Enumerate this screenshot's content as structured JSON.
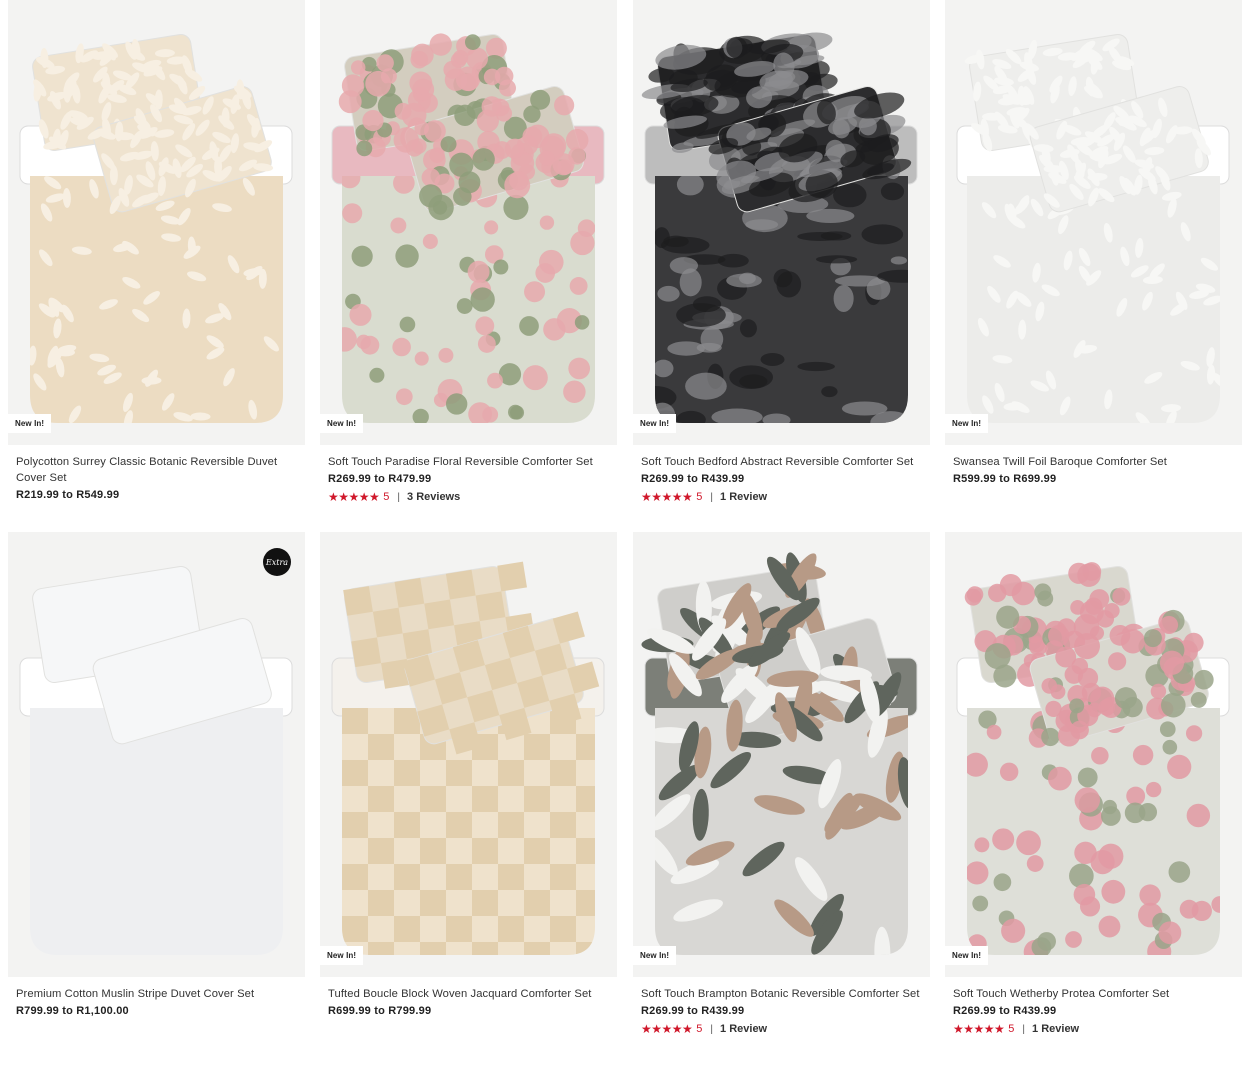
{
  "colors": {
    "accent": "#d0182b",
    "image_bg": "#f3f3f2"
  },
  "products": [
    {
      "title": "Polycotton Surrey Classic Botanic Reversible Duvet Cover Set",
      "price": "R219.99 to R549.99",
      "badge": "New In!",
      "pattern": "beige-botanic"
    },
    {
      "title": "Soft Touch Paradise Floral Reversible Comforter Set",
      "price": "R269.99 to R479.99",
      "badge": "New In!",
      "rating": {
        "stars": "★★★★★",
        "score": "5",
        "reviews": "3 Reviews"
      },
      "pattern": "pink-floral"
    },
    {
      "title": "Soft Touch Bedford Abstract Reversible Comforter Set",
      "price": "R269.99 to R439.99",
      "badge": "New In!",
      "rating": {
        "stars": "★★★★★",
        "score": "5",
        "reviews": "1 Review"
      },
      "pattern": "black-abstract"
    },
    {
      "title": "Swansea Twill Foil Baroque Comforter Set",
      "price": "R599.99 to R699.99",
      "badge": "New In!",
      "pattern": "white-baroque"
    },
    {
      "title": "Premium Cotton Muslin Stripe Duvet Cover Set",
      "price": "R799.99 to R1,100.00",
      "extra_badge": "Extra",
      "pattern": "white-plain"
    },
    {
      "title": "Tufted Boucle Block Woven Jacquard Comforter Set",
      "price": "R699.99 to R799.99",
      "badge": "New In!",
      "pattern": "beige-check"
    },
    {
      "title": "Soft Touch Brampton Botanic Reversible Comforter Set",
      "price": "R269.99 to R439.99",
      "badge": "New In!",
      "rating": {
        "stars": "★★★★★",
        "score": "5",
        "reviews": "1 Review"
      },
      "pattern": "grey-leaves"
    },
    {
      "title": "Soft Touch Wetherby Protea Comforter Set",
      "price": "R269.99 to R439.99",
      "badge": "New In!",
      "rating": {
        "stars": "★★★★★",
        "score": "5",
        "reviews": "1 Review"
      },
      "pattern": "protea"
    }
  ]
}
